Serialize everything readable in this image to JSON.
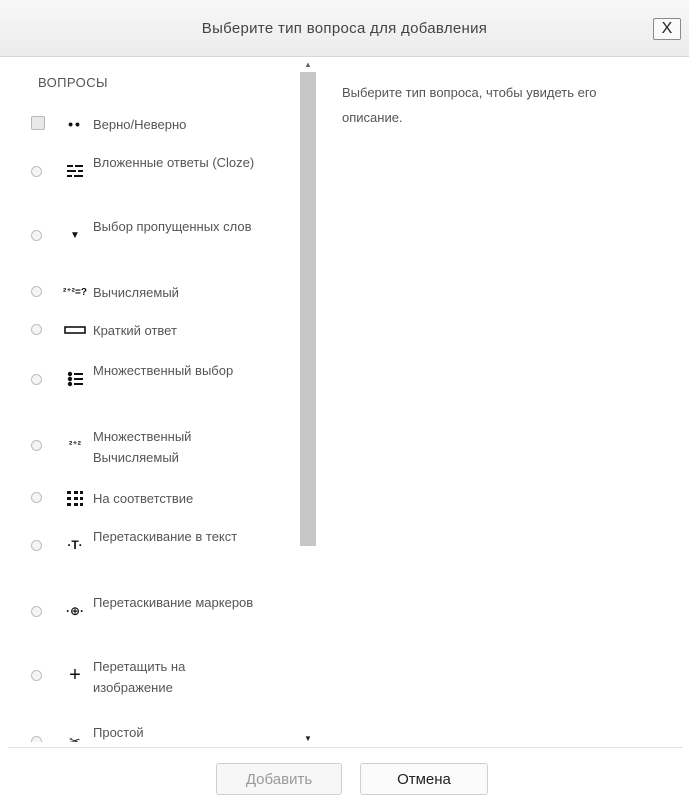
{
  "dialog": {
    "title": "Выберите тип вопроса для добавления",
    "close_label": "X"
  },
  "questions": {
    "heading": "ВОПРОСЫ",
    "items": [
      {
        "label": "Верно/Неверно",
        "icon": "two-dots-icon",
        "glyph": "••"
      },
      {
        "label": "Вложенные ответы (Cloze)",
        "icon": "cloze-icon",
        "glyph": "▬"
      },
      {
        "label": "Выбор пропущенных слов",
        "icon": "dropdown-arrow-icon",
        "glyph": "▼"
      },
      {
        "label": "Вычисляемый",
        "icon": "calculated-icon",
        "glyph": "²⁺²=?"
      },
      {
        "label": "Краткий ответ",
        "icon": "short-answer-icon",
        "glyph": ""
      },
      {
        "label": "Множественный выбор",
        "icon": "multichoice-icon",
        "glyph": ""
      },
      {
        "label": "Множественный Вычисляемый",
        "icon": "calculated-multi-icon",
        "glyph": "²⁺²"
      },
      {
        "label": "На соответствие",
        "icon": "match-icon",
        "glyph": ""
      },
      {
        "label": "Перетаскивание в текст",
        "icon": "drag-text-icon",
        "glyph": "·T·"
      },
      {
        "label": "Перетаскивание маркеров",
        "icon": "drag-markers-icon",
        "glyph": "·⊕·"
      },
      {
        "label": "Перетащить на изображение",
        "icon": "drag-image-icon",
        "glyph": "+"
      },
      {
        "label": "Простой",
        "icon": "simple-icon",
        "glyph": "✂"
      }
    ]
  },
  "description": {
    "text": "Выберите тип вопроса, чтобы увидеть его описание."
  },
  "buttons": {
    "add": "Добавить",
    "cancel": "Отмена"
  }
}
